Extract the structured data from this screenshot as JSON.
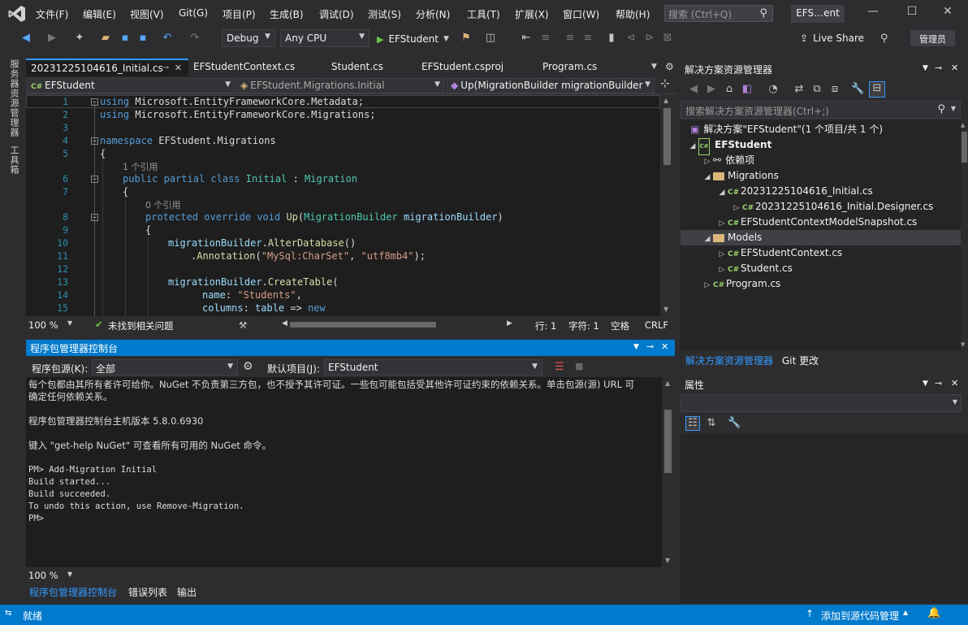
{
  "menubar": {
    "items": [
      "文件(F)",
      "编辑(E)",
      "视图(V)",
      "Git(G)",
      "项目(P)",
      "生成(B)",
      "调试(D)",
      "测试(S)",
      "分析(N)",
      "工具(T)",
      "扩展(X)",
      "窗口(W)",
      "帮助(H)"
    ],
    "search_placeholder": "搜索 (Ctrl+Q)",
    "solution_name": "EFS…ent",
    "minimize": "—",
    "maximize": "☐",
    "close": "✕"
  },
  "toolbar": {
    "config": "Debug",
    "platform": "Any CPU",
    "start_label": "EFStudent",
    "live_share": "Live Share",
    "admin": "管理员"
  },
  "leftbar": {
    "server_explorer": "服务器资源管理器",
    "toolbox": "工具箱"
  },
  "editor": {
    "tabs": [
      "20231225104616_Initial.cs",
      "EFStudentContext.cs",
      "Student.cs",
      "EFStudent.csproj",
      "Program.cs"
    ],
    "nav_project": "EFStudent",
    "nav_class": "EFStudent.Migrations.Initial",
    "nav_member": "Up(MigrationBuilder migrationBuilder",
    "line_numbers": [
      "1",
      "2",
      "3",
      "4",
      "5",
      "6",
      "7",
      "8",
      "9",
      "10",
      "11",
      "12",
      "13",
      "14",
      "15"
    ],
    "code": {
      "l1_kw": "using",
      "l1_rest": " Microsoft.EntityFrameworkCore.Metadata;",
      "l2_kw": "using",
      "l2_rest": " Microsoft.EntityFrameworkCore.Migrations;",
      "l4_kw": "namespace",
      "l4_rest": " EFStudent.Migrations",
      "l5": "{",
      "lens1": "1 个引用",
      "l6_kw1": "public",
      "l6_kw2": "partial",
      "l6_kw3": "class",
      "l6_ty1": "Initial",
      "l6_colon": " : ",
      "l6_ty2": "Migration",
      "l7": "{",
      "lens2": "0 个引用",
      "l8_kw1": "protected",
      "l8_kw2": "override",
      "l8_kw3": "void",
      "l8_mt": "Up",
      "l8_p1": "(",
      "l8_ty": "MigrationBuilder",
      "l8_pm": "migrationBuilder",
      "l8_p2": ")",
      "l9": "{",
      "l10_pm": "migrationBuilder",
      "l10_dot": ".",
      "l10_mt": "AlterDatabase",
      "l10_end": "()",
      "l11_dot": ".",
      "l11_mt": "Annotation",
      "l11_p1": "(",
      "l11_s1": "\"MySql:CharSet\"",
      "l11_c": ", ",
      "l11_s2": "\"utf8mb4\"",
      "l11_end": ");",
      "l13_pm": "migrationBuilder",
      "l13_dot": ".",
      "l13_mt": "CreateTable",
      "l13_end": "(",
      "l14_pm": "name",
      "l14_c": ": ",
      "l14_s": "\"Students\"",
      "l14_end": ",",
      "l15_pm": "columns",
      "l15_c": ": ",
      "l15_pm2": "table",
      "l15_arrow": " => ",
      "l15_kw": "new"
    },
    "zoom": "100 %",
    "issues": "未找到相关问题",
    "line": "行: 1",
    "char": "字符: 1",
    "space": "空格",
    "eol": "CRLF"
  },
  "pmc": {
    "title": "程序包管理器控制台",
    "source_label": "程序包源(K):",
    "source_value": "全部",
    "default_project_label": "默认项目(J):",
    "default_project_value": "EFStudent",
    "lines": [
      "每个包都由其所有者许可给你。NuGet 不负责第三方包，也不授予其许可证。一些包可能包括受其他许可证约束的依赖关系。单击包源(源) URL 可",
      "确定任何依赖关系。",
      "",
      "程序包管理器控制台主机版本 5.8.0.6930",
      "",
      "键入 \"get-help NuGet\" 可查看所有可用的 NuGet 命令。",
      "",
      "PM> Add-Migration Initial",
      "Build started...",
      "Build succeeded.",
      "To undo this action, use Remove-Migration.",
      "PM>"
    ],
    "zoom": "100 %"
  },
  "bottom_tabs": [
    "程序包管理器控制台",
    "错误列表",
    "输出"
  ],
  "solution_explorer": {
    "title": "解决方案资源管理器",
    "search_placeholder": "搜索解决方案资源管理器(Ctrl+;)",
    "nodes": {
      "solution": "解决方案\"EFStudent\"(1 个项目/共 1 个)",
      "project": "EFStudent",
      "deps": "依赖项",
      "migrations": "Migrations",
      "initial": "20231225104616_Initial.cs",
      "designer": "20231225104616_Initial.Designer.cs",
      "snapshot": "EFStudentContextModelSnapshot.cs",
      "models": "Models",
      "context": "EFStudentContext.cs",
      "student": "Student.cs",
      "program": "Program.cs"
    },
    "tabs": [
      "解决方案资源管理器",
      "Git 更改"
    ]
  },
  "properties": {
    "title": "属性"
  },
  "statusbar": {
    "ready": "就绪",
    "add_source": "添加到源代码管理"
  }
}
